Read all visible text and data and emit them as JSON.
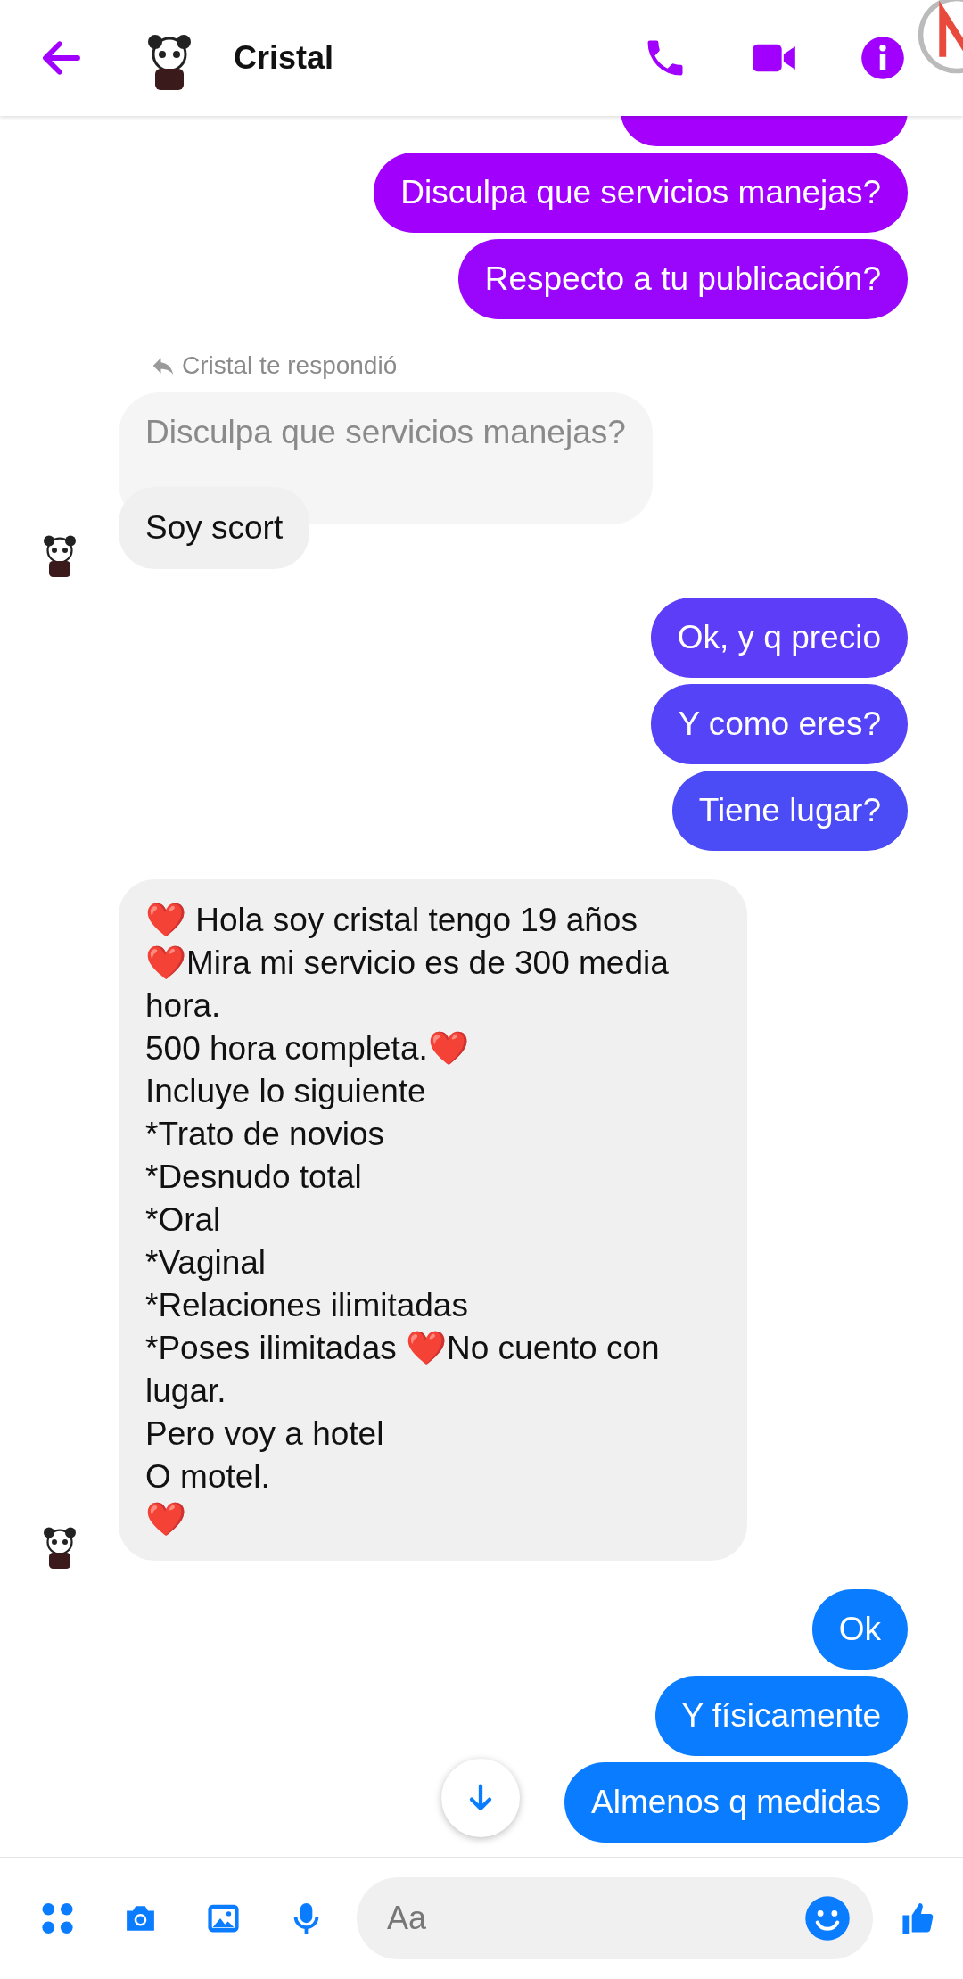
{
  "header": {
    "name": "Cristal"
  },
  "messages": [
    {
      "kind": "sent-cut",
      "color": "#a400fc"
    },
    {
      "kind": "sent",
      "text": "Disculpa que servicios manejas?",
      "color": "#a000fc"
    },
    {
      "kind": "sent",
      "text": "Respecto a tu publicación?",
      "color": "#9a06fb"
    },
    {
      "kind": "reply-note",
      "text": "Cristal te respondió"
    },
    {
      "kind": "quote",
      "text": "Disculpa que servicios manejas?"
    },
    {
      "kind": "received",
      "text": "Soy scort",
      "avatar": true
    },
    {
      "kind": "sent",
      "text": "Ok, y q precio",
      "color": "#5d3df8"
    },
    {
      "kind": "sent",
      "text": "Y como eres?",
      "color": "#5544f7"
    },
    {
      "kind": "sent",
      "text": "Tiene lugar?",
      "color": "#4b4cf6"
    },
    {
      "kind": "received",
      "text": "❤️ Hola soy cristal tengo 19 años\n❤️Mira mi servicio es de 300 media hora.\n500 hora completa.❤️\nIncluye lo siguiente\n*Trato de novios\n*Desnudo total\n*Oral\n*Vaginal\n*Relaciones ilimitadas\n*Poses ilimitadas ❤️No cuento con lugar.\nPero voy a hotel\nO motel.\n❤️",
      "avatar": true
    },
    {
      "kind": "sent",
      "text": "Ok",
      "color": "#0a7cff"
    },
    {
      "kind": "sent",
      "text": "Y físicamente",
      "color": "#0a7cff"
    },
    {
      "kind": "sent",
      "text": "Almenos q medidas",
      "color": "#0a7cff"
    }
  ],
  "composer": {
    "placeholder": "Aa"
  }
}
